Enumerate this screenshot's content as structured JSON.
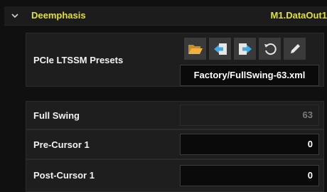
{
  "section": {
    "title": "Deemphasis",
    "source": "M1.DataOut1"
  },
  "presets": {
    "label": "PCIe LTSSM Presets",
    "file": "Factory/FullSwing-63.xml",
    "toolbar": [
      {
        "icon": "folder-open-icon",
        "action": "open"
      },
      {
        "icon": "import-arrow-icon",
        "action": "import"
      },
      {
        "icon": "export-arrow-icon",
        "action": "export"
      },
      {
        "icon": "reset-icon",
        "action": "reset"
      },
      {
        "icon": "pencil-icon",
        "action": "edit"
      }
    ]
  },
  "fields": [
    {
      "label": "Full Swing",
      "value": "63",
      "disabled": true
    },
    {
      "label": "Pre-Cursor 1",
      "value": "0",
      "disabled": false
    },
    {
      "label": "Post-Cursor 1",
      "value": "0",
      "disabled": false
    }
  ],
  "colors": {
    "accent": "#e3e02a",
    "folder": "#f0b23c",
    "arrow": "#3fa9e6",
    "background": "#101010"
  }
}
